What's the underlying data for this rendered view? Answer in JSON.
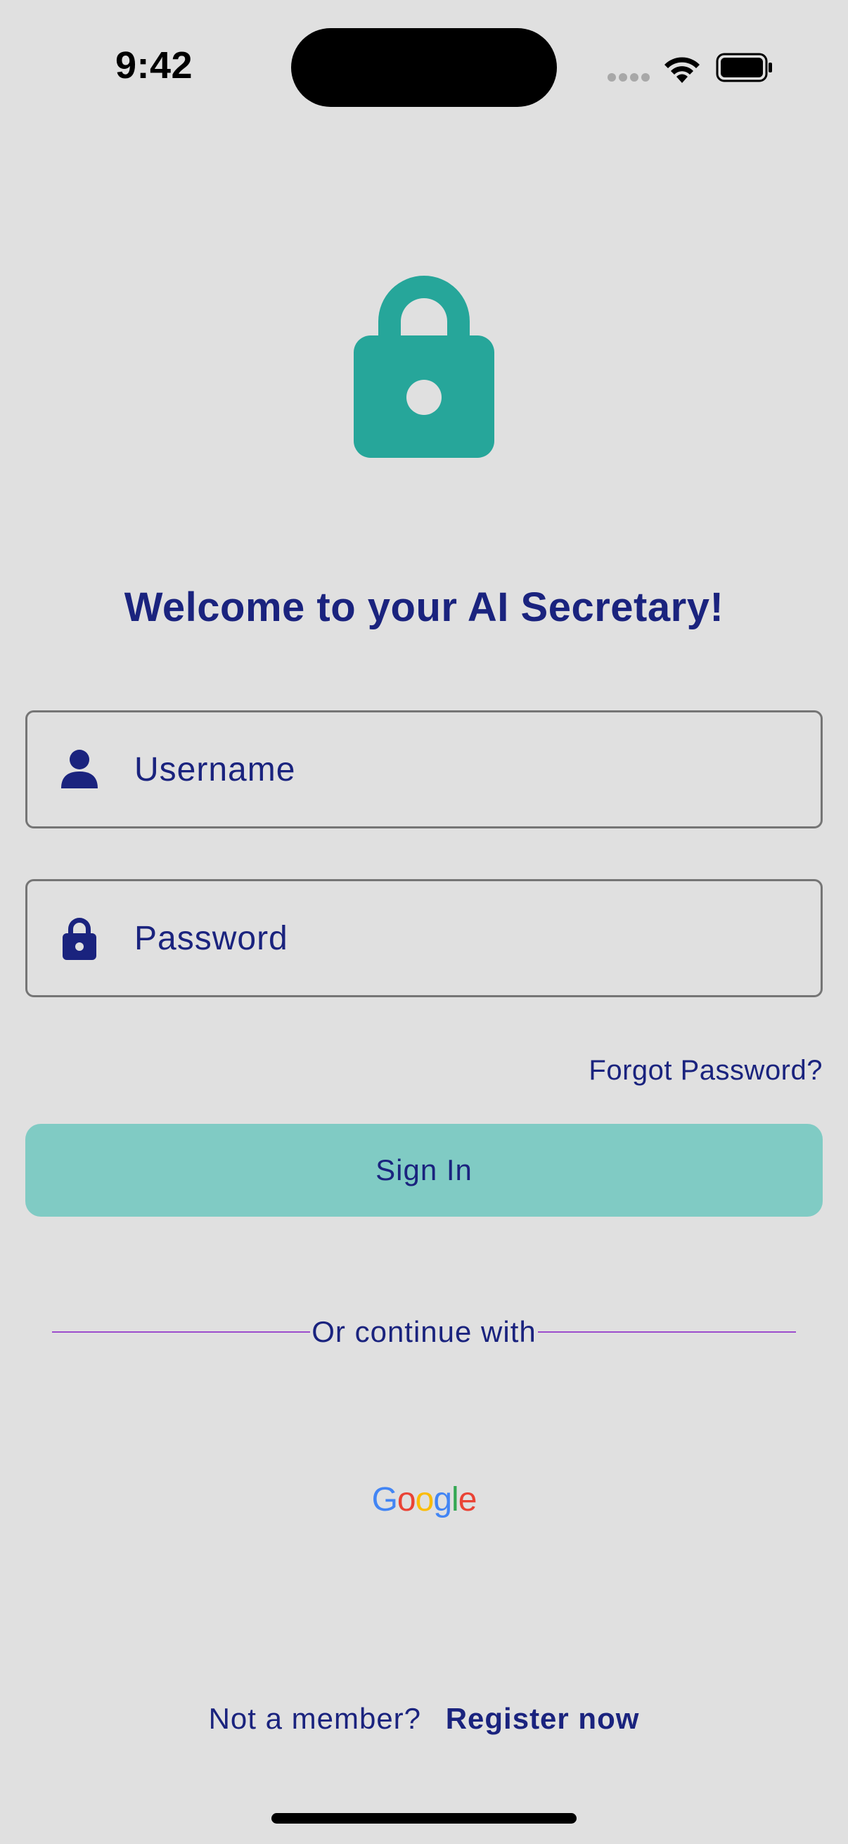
{
  "status_bar": {
    "time": "9:42"
  },
  "app": {
    "logo_icon": "lock-icon",
    "title": "Welcome to your AI Secretary!"
  },
  "form": {
    "username": {
      "placeholder": "Username",
      "value": "",
      "icon": "person-icon"
    },
    "password": {
      "placeholder": "Password",
      "value": "",
      "icon": "lock-icon"
    },
    "forgot_label": "Forgot Password?",
    "signin_label": "Sign In"
  },
  "divider": {
    "label": "Or continue with"
  },
  "social": {
    "google_label": "Google"
  },
  "footer": {
    "prompt": "Not a member?",
    "register_label": "Register now"
  },
  "colors": {
    "background": "#e0e0e0",
    "accent": "#26a69a",
    "button": "#80cbc4",
    "text": "#1a237e",
    "divider": "#9c4dcc"
  }
}
